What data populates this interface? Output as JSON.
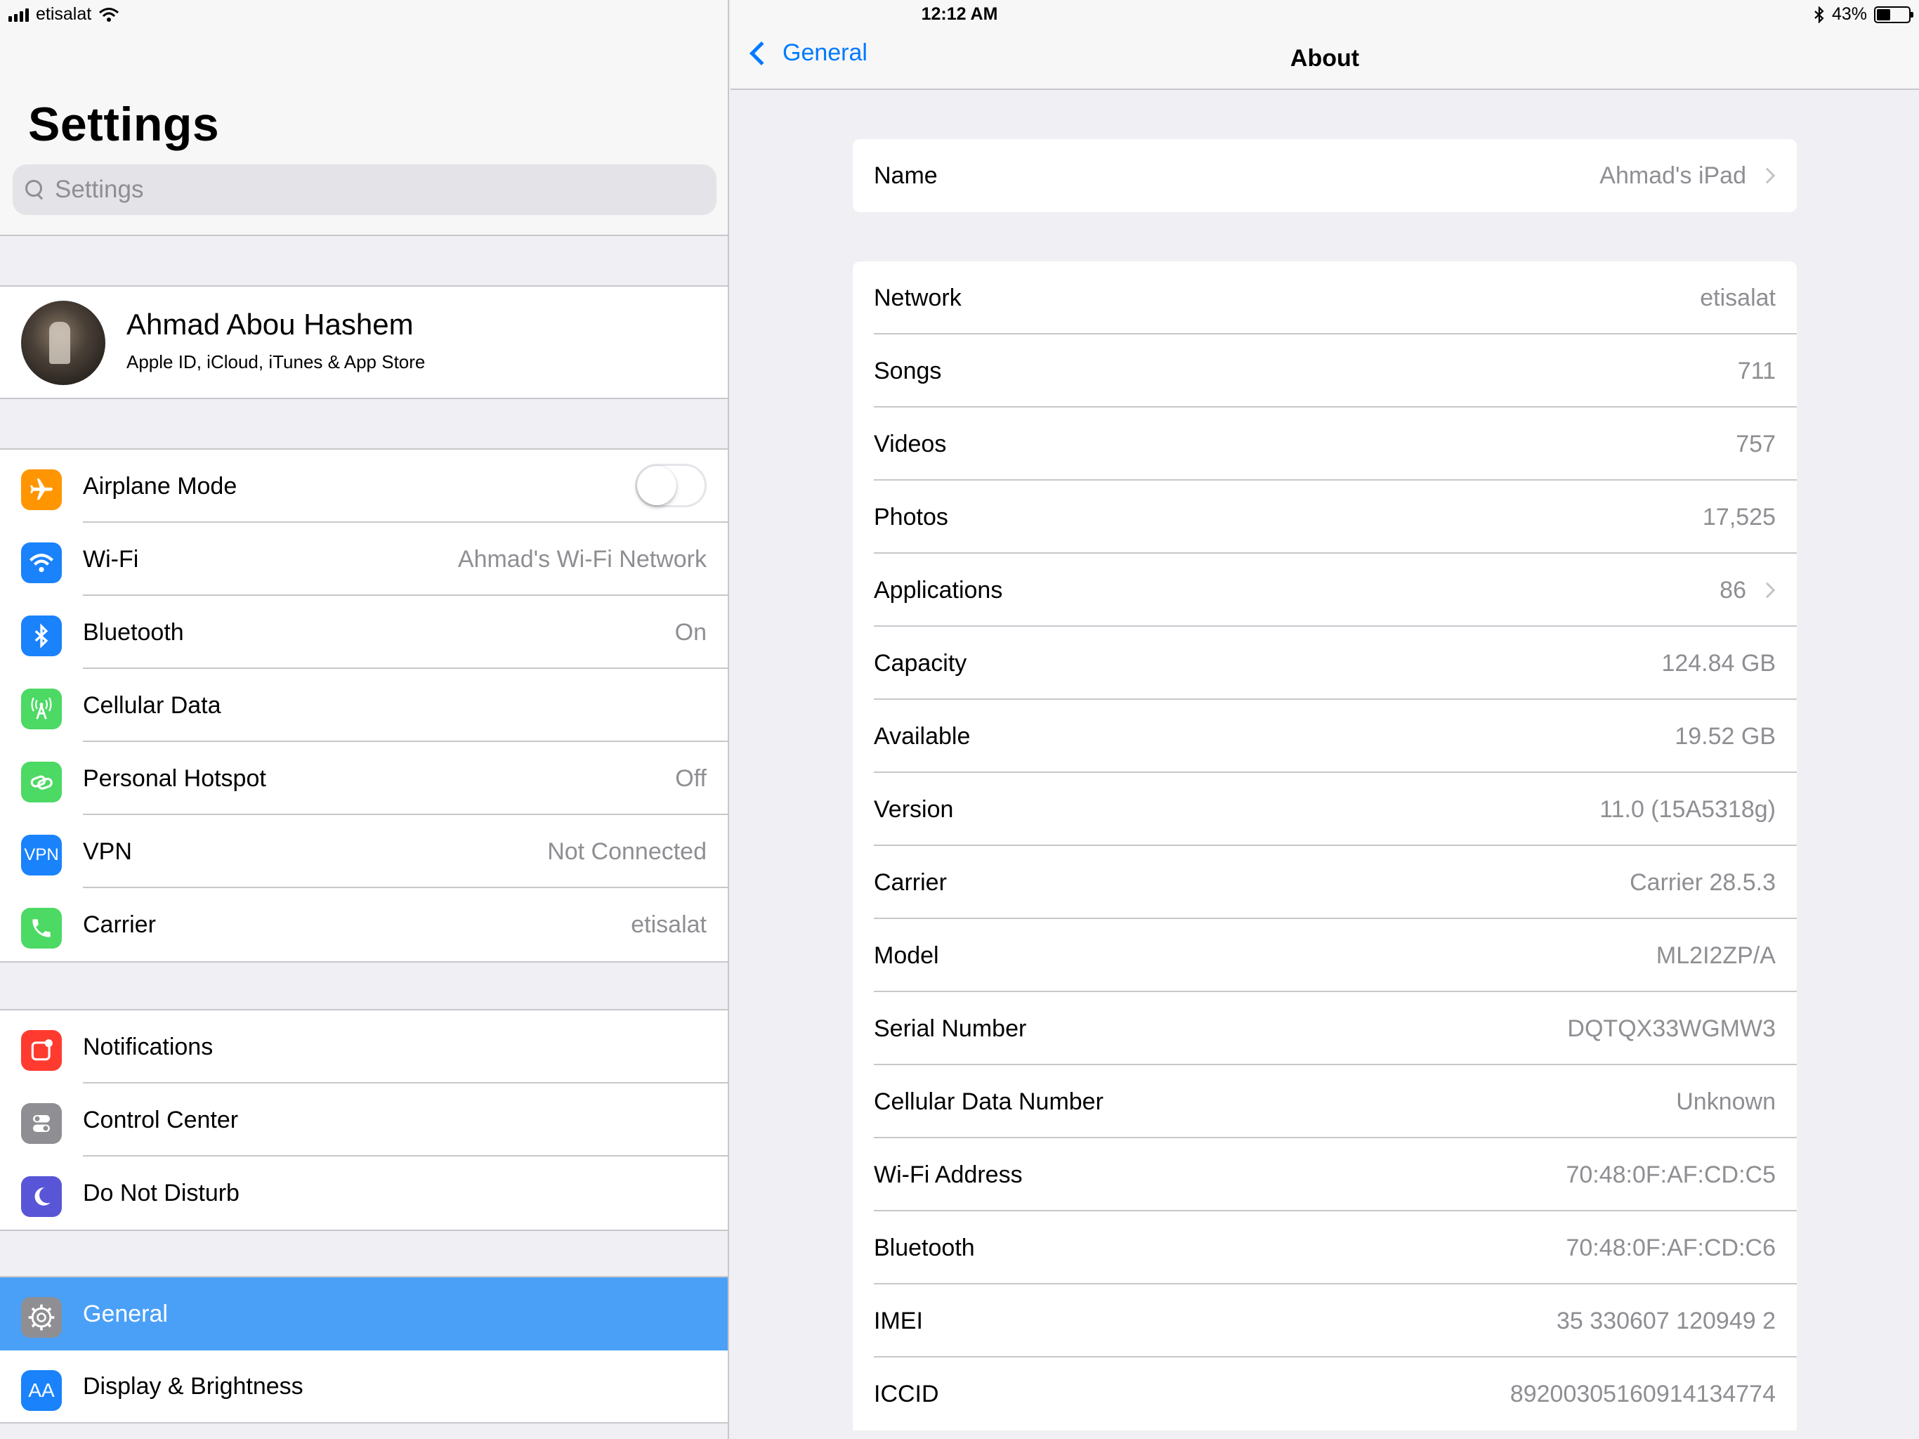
{
  "status": {
    "carrier": "etisalat",
    "time": "12:12 AM",
    "battery": "43%"
  },
  "sidebar": {
    "title": "Settings",
    "search_placeholder": "Settings",
    "profile": {
      "name": "Ahmad Abou Hashem",
      "subtitle": "Apple ID, iCloud, iTunes & App Store"
    },
    "group1": [
      {
        "label": "Airplane Mode",
        "value": "",
        "icon": "airplane-icon",
        "color": "#ff9500",
        "toggle": false
      },
      {
        "label": "Wi-Fi",
        "value": "Ahmad's Wi-Fi Network",
        "icon": "wifi-icon",
        "color": "#1a82fb"
      },
      {
        "label": "Bluetooth",
        "value": "On",
        "icon": "bluetooth-icon",
        "color": "#1a82fb"
      },
      {
        "label": "Cellular Data",
        "value": "",
        "icon": "cellular-antenna-icon",
        "color": "#4cd964"
      },
      {
        "label": "Personal Hotspot",
        "value": "Off",
        "icon": "hotspot-chain-icon",
        "color": "#4cd964"
      },
      {
        "label": "VPN",
        "value": "Not Connected",
        "icon": "vpn-icon",
        "icon_text": "VPN",
        "color": "#1a82fb"
      },
      {
        "label": "Carrier",
        "value": "etisalat",
        "icon": "phone-icon",
        "color": "#4cd964"
      }
    ],
    "group2": [
      {
        "label": "Notifications",
        "icon": "notifications-icon",
        "color": "#ff3b30"
      },
      {
        "label": "Control Center",
        "icon": "control-center-icon",
        "color": "#8e8e93"
      },
      {
        "label": "Do Not Disturb",
        "icon": "moon-icon",
        "color": "#5856d6"
      }
    ],
    "group3": [
      {
        "label": "General",
        "icon": "gear-icon",
        "color": "#8e8e93",
        "selected": true
      },
      {
        "label": "Display & Brightness",
        "icon": "display-aa-icon",
        "icon_text": "AA",
        "color": "#1a82fb"
      }
    ]
  },
  "detail": {
    "back_label": "General",
    "title": "About",
    "name_row": {
      "label": "Name",
      "value": "Ahmad's iPad"
    },
    "rows": [
      {
        "label": "Network",
        "value": "etisalat"
      },
      {
        "label": "Songs",
        "value": "711"
      },
      {
        "label": "Videos",
        "value": "757"
      },
      {
        "label": "Photos",
        "value": "17,525"
      },
      {
        "label": "Applications",
        "value": "86",
        "chevron": true
      },
      {
        "label": "Capacity",
        "value": "124.84 GB"
      },
      {
        "label": "Available",
        "value": "19.52 GB"
      },
      {
        "label": "Version",
        "value": "11.0 (15A5318g)"
      },
      {
        "label": "Carrier",
        "value": "Carrier 28.5.3"
      },
      {
        "label": "Model",
        "value": "ML2I2ZP/A"
      },
      {
        "label": "Serial Number",
        "value": "DQTQX33WGMW3"
      },
      {
        "label": "Cellular Data Number",
        "value": "Unknown"
      },
      {
        "label": "Wi-Fi Address",
        "value": "70:48:0F:AF:CD:C5"
      },
      {
        "label": "Bluetooth",
        "value": "70:48:0F:AF:CD:C6"
      },
      {
        "label": "IMEI",
        "value": "35 330607 120949 2"
      },
      {
        "label": "ICCID",
        "value": "89200305160914134774"
      }
    ]
  }
}
